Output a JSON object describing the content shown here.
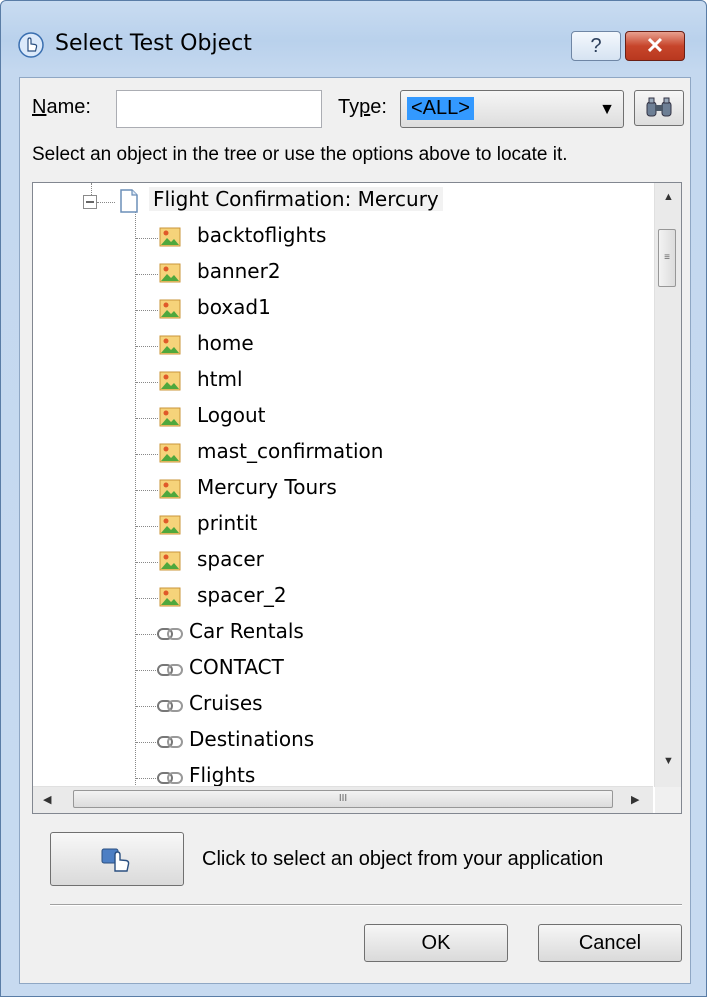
{
  "window": {
    "title": "Select Test Object",
    "help_label": "?",
    "close_label": "✕"
  },
  "filters": {
    "name_label": "Name:",
    "name_value": "",
    "type_label": "Type:",
    "type_value": "<ALL>",
    "find_icon": "binoculars-icon"
  },
  "hint": "Select an object in the tree or use the options above to locate it.",
  "tree": {
    "root": {
      "label": "Flight Confirmation: Mercury",
      "icon": "page-icon",
      "expanded": true
    },
    "children": [
      {
        "label": "backtoflights",
        "icon": "image-icon"
      },
      {
        "label": "banner2",
        "icon": "image-icon"
      },
      {
        "label": "boxad1",
        "icon": "image-icon"
      },
      {
        "label": "home",
        "icon": "image-icon"
      },
      {
        "label": "html",
        "icon": "image-icon"
      },
      {
        "label": "Logout",
        "icon": "image-icon"
      },
      {
        "label": "mast_confirmation",
        "icon": "image-icon"
      },
      {
        "label": "Mercury Tours",
        "icon": "image-icon"
      },
      {
        "label": "printit",
        "icon": "image-icon"
      },
      {
        "label": "spacer",
        "icon": "image-icon"
      },
      {
        "label": "spacer_2",
        "icon": "image-icon"
      },
      {
        "label": "Car Rentals",
        "icon": "link-icon"
      },
      {
        "label": "CONTACT",
        "icon": "link-icon"
      },
      {
        "label": "Cruises",
        "icon": "link-icon"
      },
      {
        "label": "Destinations",
        "icon": "link-icon"
      },
      {
        "label": "Flights",
        "icon": "link-icon"
      }
    ]
  },
  "pick": {
    "icon": "pointing-hand-icon",
    "text": "Click to select an object from your application"
  },
  "buttons": {
    "ok": "OK",
    "cancel": "Cancel"
  },
  "colors": {
    "titlebar": "#b9d1ec",
    "close": "#c7452b",
    "selection": "#3399ff"
  }
}
